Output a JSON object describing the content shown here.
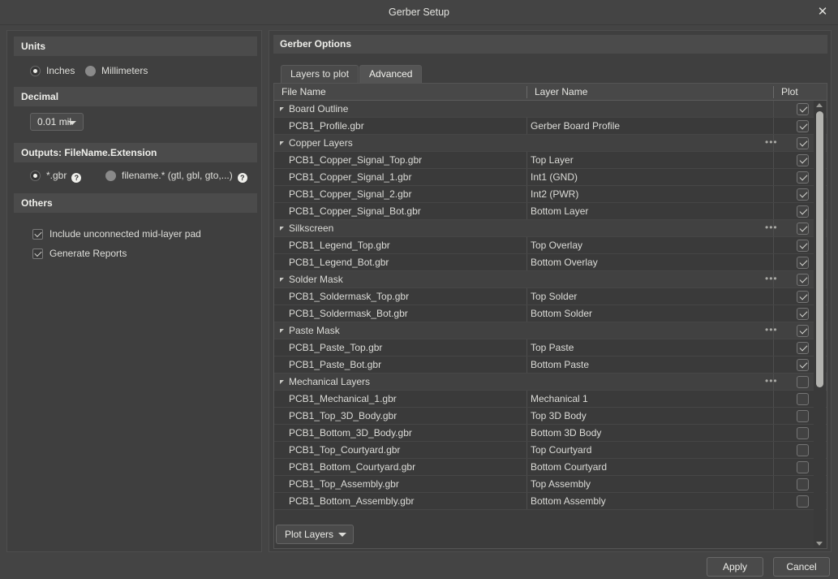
{
  "window": {
    "title": "Gerber Setup",
    "close_icon": "close-icon",
    "close_glyph": "✕"
  },
  "left_panel": {
    "units": {
      "header": "Units",
      "options": [
        {
          "label": "Inches",
          "selected": true
        },
        {
          "label": "Millimeters",
          "selected": false
        }
      ]
    },
    "decimal": {
      "header": "Decimal",
      "value": "0.01 mil",
      "arrow_icon": "chevron-down-icon"
    },
    "outputs": {
      "header": "Outputs: FileName.Extension",
      "options": [
        {
          "label": "*.gbr",
          "selected": true,
          "help": "?"
        },
        {
          "label": "filename.* (gtl, gbl, gto,...)",
          "selected": false,
          "help": "?"
        }
      ]
    },
    "others": {
      "header": "Others",
      "checkboxes": [
        {
          "label": "Include unconnected mid-layer pad",
          "checked": true
        },
        {
          "label": "Generate Reports",
          "checked": true
        }
      ]
    }
  },
  "right_panel": {
    "header": "Gerber Options",
    "tabs": [
      {
        "label": "Layers to plot",
        "active": false
      },
      {
        "label": "Advanced",
        "active": true
      }
    ],
    "table": {
      "columns": [
        "File Name",
        "Layer Name",
        "Plot"
      ],
      "ellipsis_glyph": "•••",
      "rows": [
        {
          "type": "group",
          "file": "Board Outline",
          "layer": "",
          "plot": true,
          "ellipsis": false
        },
        {
          "type": "item",
          "file": "PCB1_Profile.gbr",
          "layer": "Gerber Board Profile",
          "plot": true
        },
        {
          "type": "group",
          "file": "Copper Layers",
          "layer": "",
          "plot": true,
          "ellipsis": true
        },
        {
          "type": "item",
          "file": "PCB1_Copper_Signal_Top.gbr",
          "layer": "Top Layer",
          "plot": true
        },
        {
          "type": "item",
          "file": "PCB1_Copper_Signal_1.gbr",
          "layer": "Int1 (GND)",
          "plot": true
        },
        {
          "type": "item",
          "file": "PCB1_Copper_Signal_2.gbr",
          "layer": "Int2 (PWR)",
          "plot": true
        },
        {
          "type": "item",
          "file": "PCB1_Copper_Signal_Bot.gbr",
          "layer": "Bottom Layer",
          "plot": true
        },
        {
          "type": "group",
          "file": "Silkscreen",
          "layer": "",
          "plot": true,
          "ellipsis": true
        },
        {
          "type": "item",
          "file": "PCB1_Legend_Top.gbr",
          "layer": "Top Overlay",
          "plot": true
        },
        {
          "type": "item",
          "file": "PCB1_Legend_Bot.gbr",
          "layer": "Bottom Overlay",
          "plot": true
        },
        {
          "type": "group",
          "file": "Solder Mask",
          "layer": "",
          "plot": true,
          "ellipsis": true
        },
        {
          "type": "item",
          "file": "PCB1_Soldermask_Top.gbr",
          "layer": "Top Solder",
          "plot": true
        },
        {
          "type": "item",
          "file": "PCB1_Soldermask_Bot.gbr",
          "layer": "Bottom Solder",
          "plot": true
        },
        {
          "type": "group",
          "file": "Paste Mask",
          "layer": "",
          "plot": true,
          "ellipsis": true
        },
        {
          "type": "item",
          "file": "PCB1_Paste_Top.gbr",
          "layer": "Top Paste",
          "plot": true
        },
        {
          "type": "item",
          "file": "PCB1_Paste_Bot.gbr",
          "layer": "Bottom Paste",
          "plot": true
        },
        {
          "type": "group",
          "file": "Mechanical Layers",
          "layer": "",
          "plot": false,
          "ellipsis": true
        },
        {
          "type": "item",
          "file": "PCB1_Mechanical_1.gbr",
          "layer": "Mechanical 1",
          "plot": false
        },
        {
          "type": "item",
          "file": "PCB1_Top_3D_Body.gbr",
          "layer": "Top 3D Body",
          "plot": false
        },
        {
          "type": "item",
          "file": "PCB1_Bottom_3D_Body.gbr",
          "layer": "Bottom 3D Body",
          "plot": false
        },
        {
          "type": "item",
          "file": "PCB1_Top_Courtyard.gbr",
          "layer": "Top Courtyard",
          "plot": false
        },
        {
          "type": "item",
          "file": "PCB1_Bottom_Courtyard.gbr",
          "layer": "Bottom Courtyard",
          "plot": false
        },
        {
          "type": "item",
          "file": "PCB1_Top_Assembly.gbr",
          "layer": "Top Assembly",
          "plot": false
        },
        {
          "type": "item",
          "file": "PCB1_Bottom_Assembly.gbr",
          "layer": "Bottom Assembly",
          "plot": false
        }
      ]
    },
    "plot_layers_button": {
      "label": "Plot Layers",
      "arrow_icon": "chevron-down-icon"
    }
  },
  "footer": {
    "apply_label": "Apply",
    "cancel_label": "Cancel"
  },
  "colors": {
    "window_bg": "#444444",
    "panel_bg": "#3f3f3f",
    "group_header_bg": "#4b4b4b",
    "row_item_bg": "#3a3a3a",
    "text": "#dcdcd8",
    "scrollbar_thumb": "#b3b3af"
  }
}
